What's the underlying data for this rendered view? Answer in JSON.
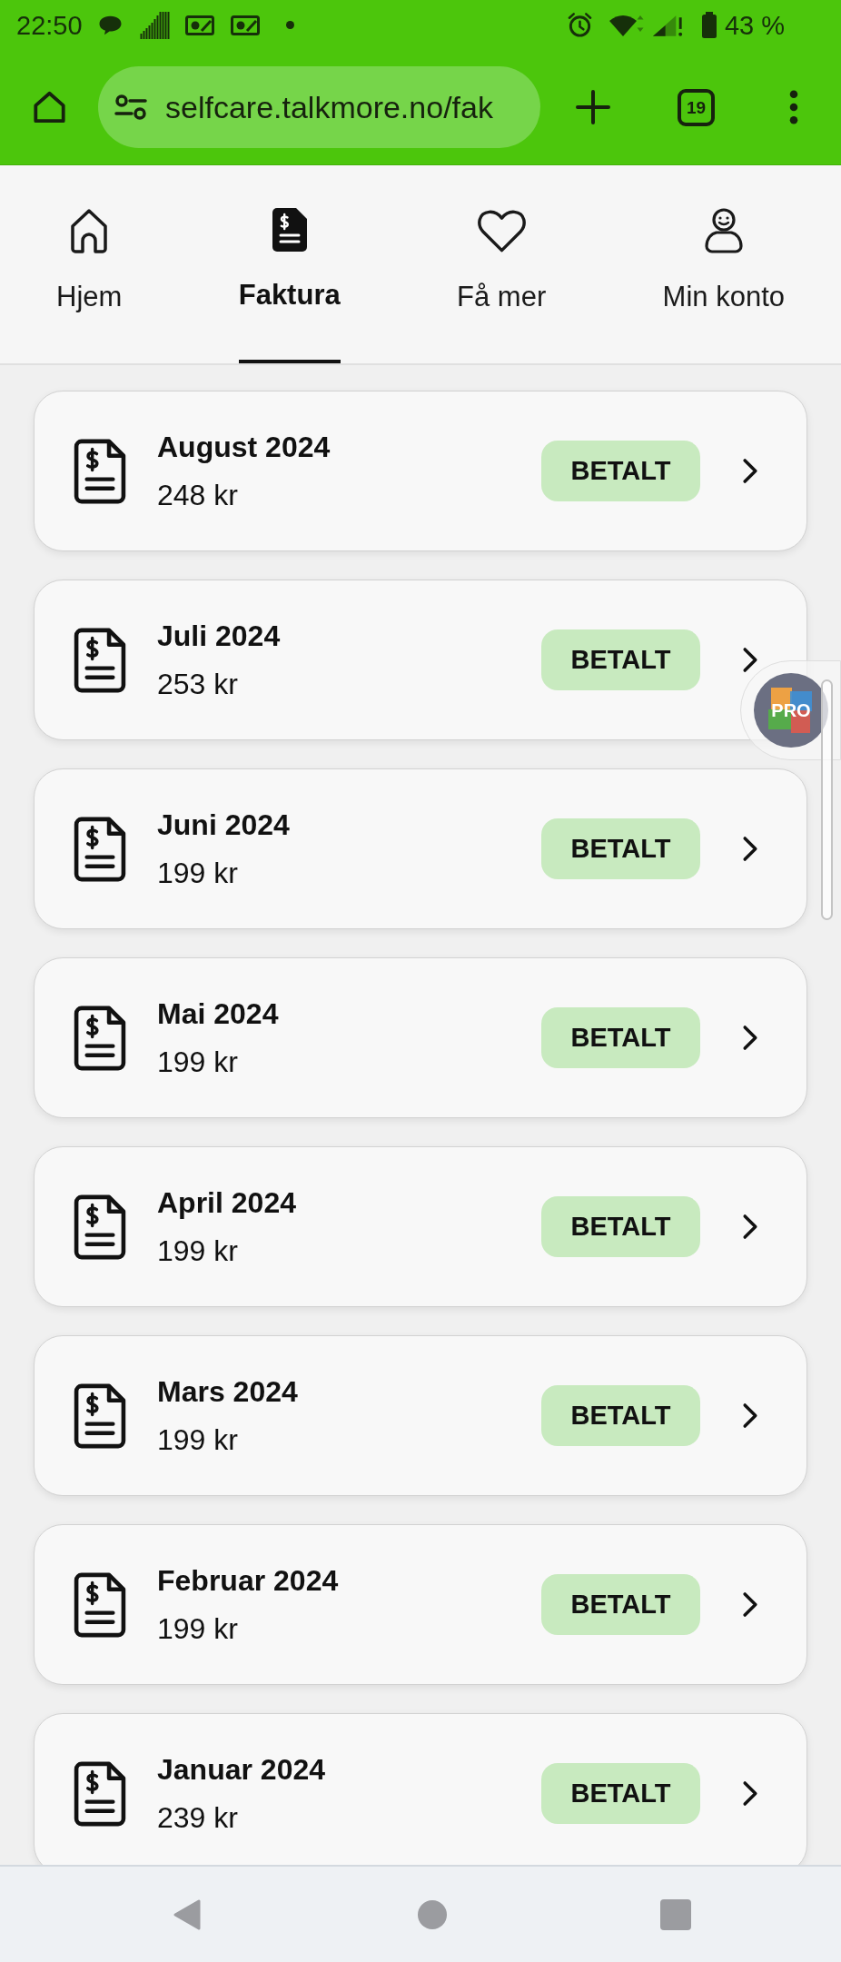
{
  "status_bar": {
    "time": "22:50",
    "battery": "43 %"
  },
  "browser_toolbar": {
    "url": "selfcare.talkmore.no/fak",
    "tab_count": "19"
  },
  "nav_tabs": [
    {
      "kind": "home",
      "label": "Hjem",
      "selected": false
    },
    {
      "kind": "invoice",
      "label": "Faktura",
      "selected": true
    },
    {
      "kind": "heart",
      "label": "Få mer",
      "selected": false
    },
    {
      "kind": "account",
      "label": "Min konto",
      "selected": false
    }
  ],
  "invoices": [
    {
      "title": "August 2024",
      "amount": "248 kr",
      "status": "BETALT"
    },
    {
      "title": "Juli 2024",
      "amount": "253 kr",
      "status": "BETALT"
    },
    {
      "title": "Juni 2024",
      "amount": "199 kr",
      "status": "BETALT"
    },
    {
      "title": "Mai 2024",
      "amount": "199 kr",
      "status": "BETALT"
    },
    {
      "title": "April 2024",
      "amount": "199 kr",
      "status": "BETALT"
    },
    {
      "title": "Mars 2024",
      "amount": "199 kr",
      "status": "BETALT"
    },
    {
      "title": "Februar 2024",
      "amount": "199 kr",
      "status": "BETALT"
    },
    {
      "title": "Januar 2024",
      "amount": "239 kr",
      "status": "BETALT"
    }
  ],
  "floating_bubble": {
    "label": "PRO"
  }
}
